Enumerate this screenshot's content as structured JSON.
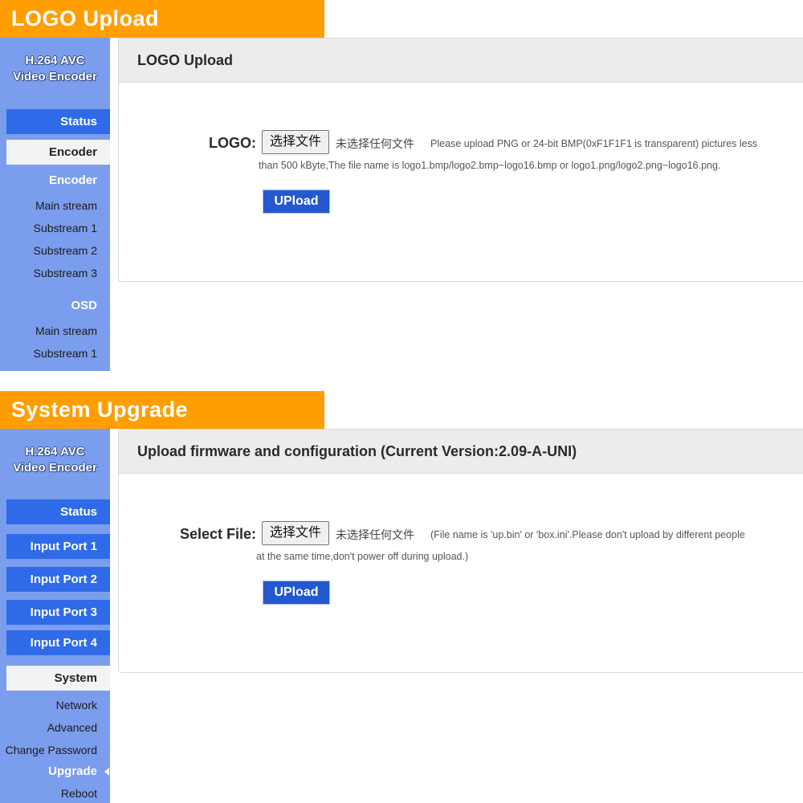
{
  "logo_section": {
    "banner": "LOGO Upload",
    "brand": [
      "H.264 AVC",
      "Video Encoder"
    ],
    "nav": {
      "status": "Status",
      "encoder": "Encoder",
      "encoder_head": "Encoder",
      "encoder_items": [
        "Main stream",
        "Substream 1",
        "Substream 2",
        "Substream 3"
      ],
      "osd_head": "OSD",
      "osd_items": [
        "Main stream",
        "Substream 1"
      ]
    },
    "panel_title": "LOGO Upload",
    "field_label": "LOGO:",
    "file_button": "选择文件",
    "no_file": "未选择任何文件",
    "hint_line1": "Please upload PNG or 24-bit BMP(0xF1F1F1 is transparent) pictures less",
    "hint_line2": "than 500 kByte,The file name is logo1.bmp/logo2.bmp~logo16.bmp or logo1.png/logo2.png~logo16.png.",
    "upload_button": "UPload"
  },
  "upgrade_section": {
    "banner": "System Upgrade",
    "brand": [
      "H.264 AVC",
      "Video Encoder"
    ],
    "nav": {
      "status": "Status",
      "input_ports": [
        "Input Port 1",
        "Input Port 2",
        "Input Port 3",
        "Input Port 4"
      ],
      "system": "System",
      "system_items": [
        "Network",
        "Advanced",
        "Change Password",
        "Upgrade",
        "Reboot"
      ]
    },
    "panel_title": "Upload firmware and configuration (Current Version:2.09-A-UNI)",
    "field_label": "Select File:",
    "file_button": "选择文件",
    "no_file": "未选择任何文件",
    "hint_line1": "(File name is 'up.bin' or 'box.ini'.Please don't upload by different people",
    "hint_line2": "at the same time,don't power off during upload.)",
    "upload_button": "UPload"
  },
  "colors": {
    "banner": "#ff9e00",
    "sidebar": "#7b9ded",
    "nav_button": "#2f6be8",
    "upload_button": "#2458cf"
  }
}
